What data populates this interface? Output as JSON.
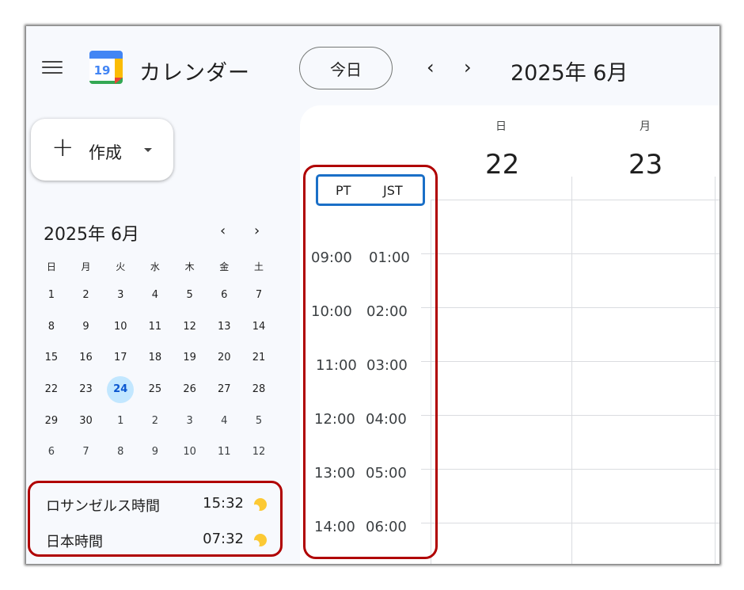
{
  "header": {
    "app_title": "カレンダー",
    "logo_number": "19",
    "today_label": "今日",
    "prev_arrow": "‹",
    "next_arrow": "›",
    "month_title": "2025年 6月"
  },
  "create": {
    "plus": "+",
    "label": "作成"
  },
  "mini_calendar": {
    "title": "2025年 6月",
    "prev": "‹",
    "next": "›",
    "weekdays": [
      "日",
      "月",
      "火",
      "水",
      "木",
      "金",
      "土"
    ],
    "weeks": [
      [
        "1",
        "2",
        "3",
        "4",
        "5",
        "6",
        "7"
      ],
      [
        "8",
        "9",
        "10",
        "11",
        "12",
        "13",
        "14"
      ],
      [
        "15",
        "16",
        "17",
        "18",
        "19",
        "20",
        "21"
      ],
      [
        "22",
        "23",
        "24",
        "25",
        "26",
        "27",
        "28"
      ],
      [
        "29",
        "30",
        "1",
        "2",
        "3",
        "4",
        "5"
      ],
      [
        "6",
        "7",
        "8",
        "9",
        "10",
        "11",
        "12"
      ]
    ],
    "today": "24"
  },
  "world_clocks": [
    {
      "name": "ロサンゼルス時間",
      "time": "15:32"
    },
    {
      "name": "日本時間",
      "time": "07:32"
    }
  ],
  "grid": {
    "days": [
      {
        "dow": "日",
        "num": "22"
      },
      {
        "dow": "月",
        "num": "23"
      }
    ],
    "timezones": [
      "PT",
      "JST"
    ],
    "time_rows": [
      {
        "pt": "09:00",
        "jst": "01:00"
      },
      {
        "pt": "10:00",
        "jst": "02:00"
      },
      {
        "pt": "11:00",
        "jst": "03:00"
      },
      {
        "pt": "12:00",
        "jst": "04:00"
      },
      {
        "pt": "13:00",
        "jst": "05:00"
      },
      {
        "pt": "14:00",
        "jst": "06:00"
      }
    ]
  },
  "colors": {
    "highlight_outline": "#b00000",
    "tz_header_outline": "#1a6fc7",
    "today_circle": "#c2e7ff"
  }
}
